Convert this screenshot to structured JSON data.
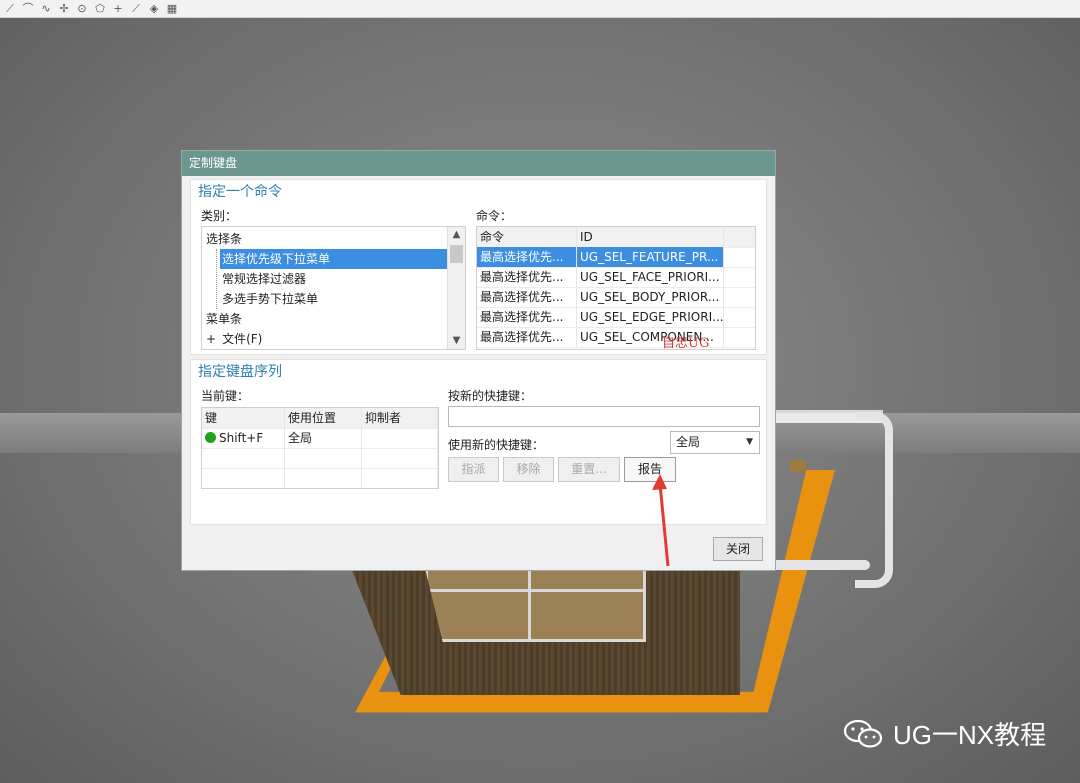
{
  "dialog": {
    "title": "定制键盘",
    "section_assign_command": "指定一个命令",
    "category_label": "类别：",
    "command_label": "命令：",
    "categories": [
      {
        "label": "选择条",
        "selected": false
      },
      {
        "label": "选择优先级下拉菜单",
        "selected": true
      },
      {
        "label": "常规选择过滤器",
        "selected": false
      },
      {
        "label": "多选手势下拉菜单",
        "selected": false
      },
      {
        "label": "菜单条",
        "selected": false
      },
      {
        "label": "文件(F)",
        "selected": false
      }
    ],
    "expand_symbol": "+",
    "command_table": {
      "headers": [
        "命令",
        "ID"
      ],
      "rows": [
        {
          "command": "最高选择优先...",
          "id": "UG_SEL_FEATURE_PR...",
          "selected": true
        },
        {
          "command": "最高选择优先...",
          "id": "UG_SEL_FACE_PRIORI...",
          "selected": false
        },
        {
          "command": "最高选择优先...",
          "id": "UG_SEL_BODY_PRIOR...",
          "selected": false
        },
        {
          "command": "最高选择优先...",
          "id": "UG_SEL_EDGE_PRIORI...",
          "selected": false
        },
        {
          "command": "最高选择优先...",
          "id": "UG_SEL_COMPONEN...",
          "selected": false
        }
      ]
    },
    "overlay_text": "自忠UG",
    "section_assign_keys": "指定键盘序列",
    "current_keys_label": "当前键：",
    "keys_table": {
      "headers": [
        "键",
        "使用位置",
        "抑制者"
      ],
      "rows": [
        {
          "key": "Shift+F",
          "scope": "全局",
          "suppressed_by": ""
        }
      ]
    },
    "new_shortcut_label": "按新的快捷键：",
    "new_shortcut_value": "",
    "use_new_shortcut_label": "使用新的快捷键：",
    "scope_value": "全局",
    "buttons": {
      "assign": "指派",
      "remove": "移除",
      "reset": "重置...",
      "report": "报告",
      "close": "关闭"
    }
  },
  "brand": {
    "text": "UG一NX教程"
  },
  "colors": {
    "title_bar": "#6b9790",
    "section_title": "#2f7fb5",
    "selection": "#3b8ee0",
    "arrow": "#e53935",
    "model_orange": "#e8920f"
  }
}
